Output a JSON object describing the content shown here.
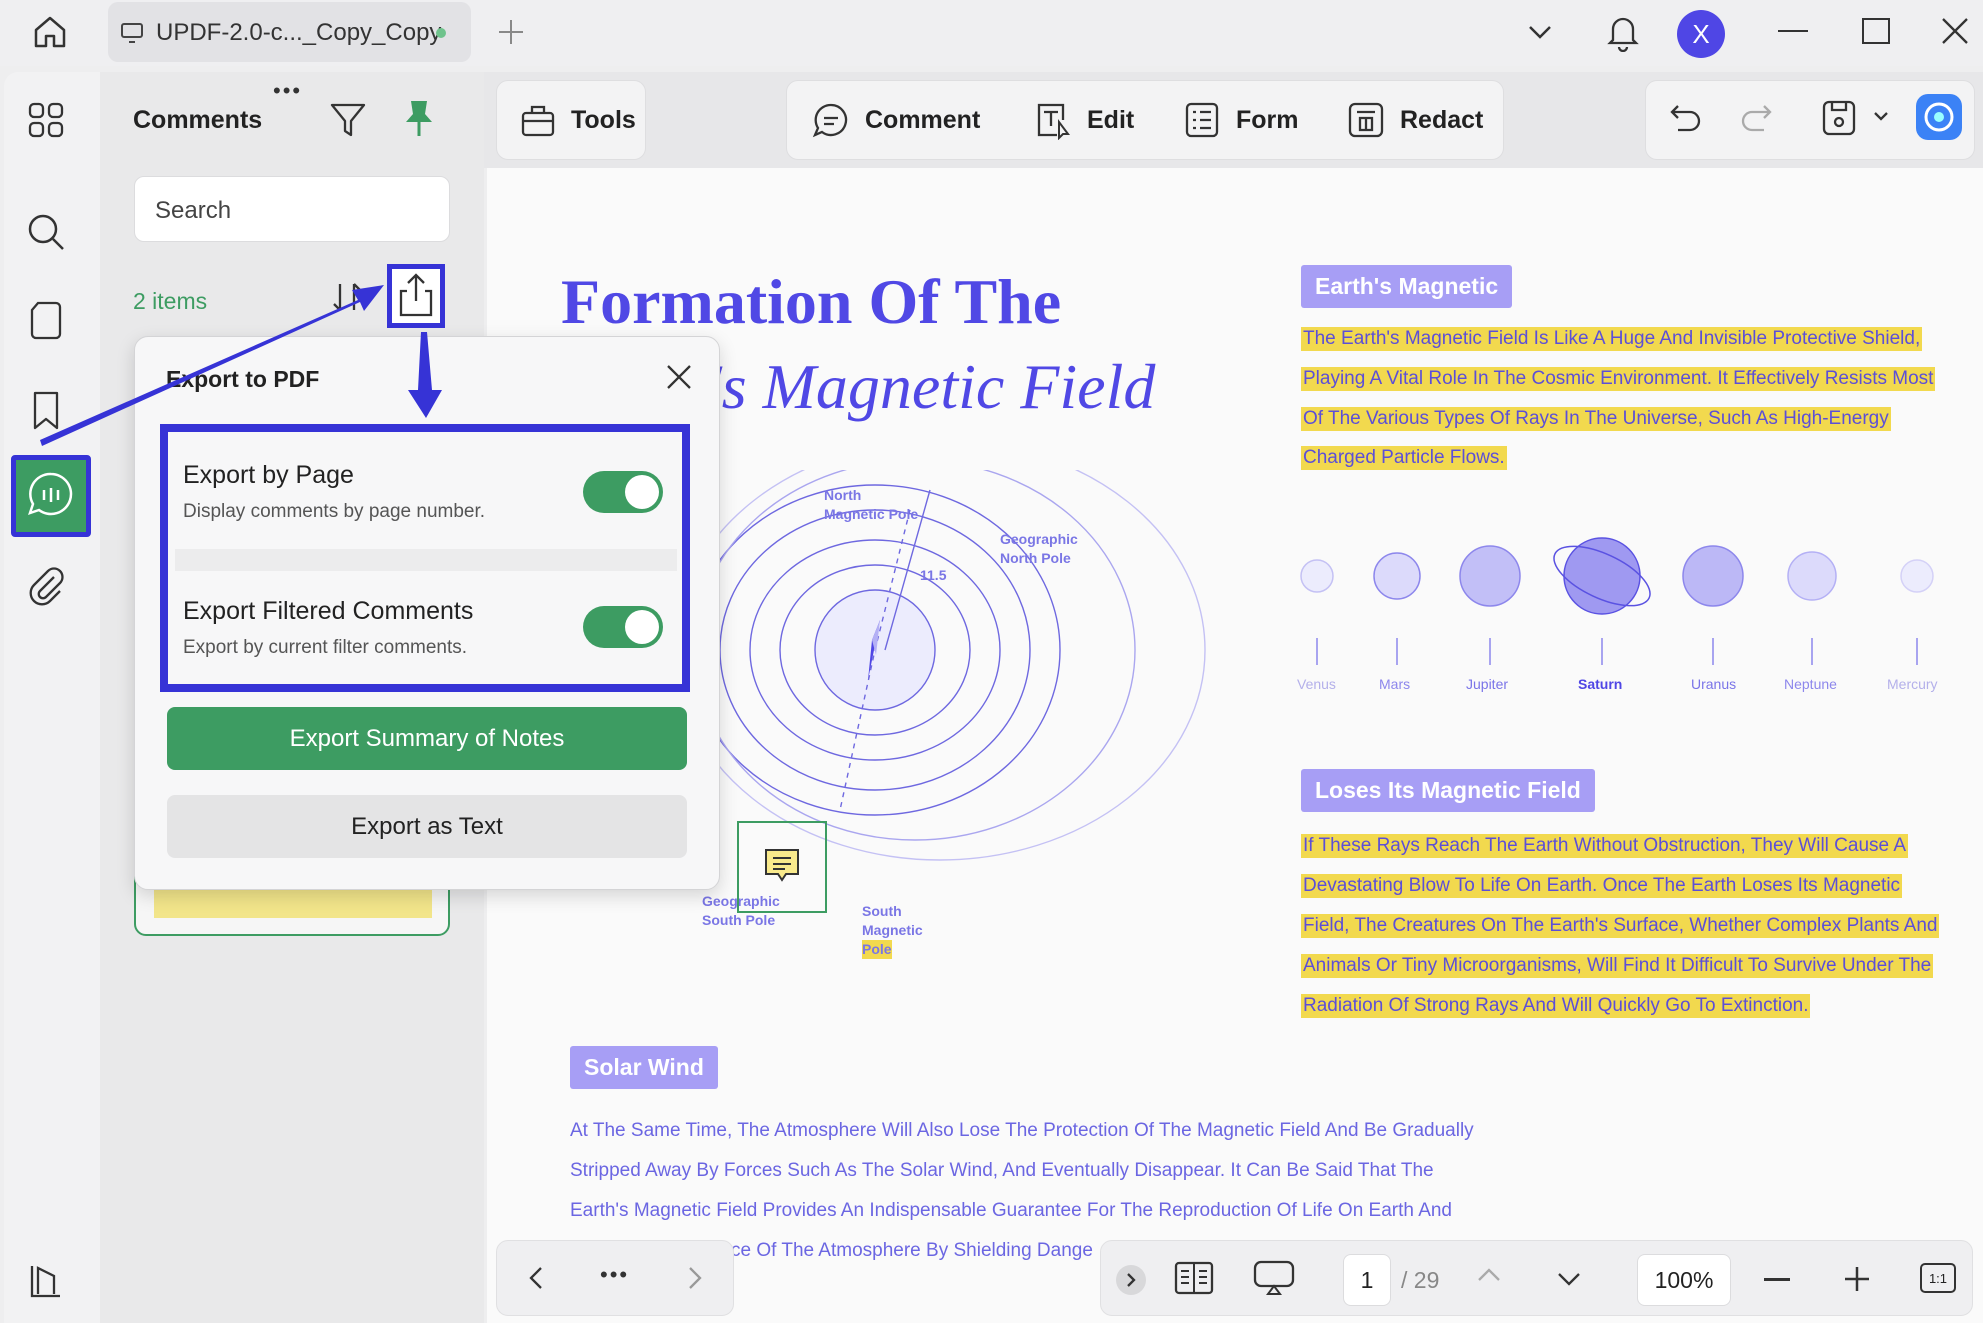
{
  "tab": {
    "title": "UPDF-2.0-c..._Copy_Copy"
  },
  "user": {
    "initial": "X"
  },
  "comments_panel": {
    "title": "Comments",
    "search_placeholder": "Search",
    "items_count": "2 items"
  },
  "toolbar": {
    "tools": "Tools",
    "comment": "Comment",
    "edit": "Edit",
    "form": "Form",
    "redact": "Redact"
  },
  "export_popup": {
    "title": "Export to PDF",
    "options": [
      {
        "title": "Export by Page",
        "subtitle": "Display comments by page number.",
        "enabled": true
      },
      {
        "title": "Export Filtered Comments",
        "subtitle": "Export by current filter comments.",
        "enabled": true
      }
    ],
    "primary_button": "Export Summary of Notes",
    "secondary_button": "Export as Text"
  },
  "document": {
    "heading_line1": "Formation Of The",
    "heading_line2": "'s Magnetic Field",
    "section1_title": "Earth's Magnetic",
    "section1_lines": [
      "The Earth's Magnetic Field Is Like A Huge And Invisible Protective Shield,",
      "Playing A Vital Role In The Cosmic Environment. It Effectively Resists Most",
      "Of The Various Types Of Rays In The Universe, Such As High-Energy",
      "Charged Particle Flows."
    ],
    "planets": [
      "Venus",
      "Mars",
      "Jupiter",
      "Saturn",
      "Uranus",
      "Neptune",
      "Mercury"
    ],
    "section2_title": "Loses Its Magnetic Field",
    "section2_lines": [
      "If These Rays Reach The Earth Without Obstruction, They Will Cause A",
      "Devastating Blow To Life On Earth. Once The Earth Loses Its Magnetic",
      "Field, The Creatures On The Earth's Surface, Whether Complex Plants And",
      "Animals Or Tiny Microorganisms, Will Find It Difficult To Survive Under The",
      "Radiation Of Strong Rays And Will Quickly Go To Extinction."
    ],
    "section3_title": "Solar Wind",
    "section3_lines": [
      "At The Same Time, The Atmosphere Will Also Lose The Protection Of The Magnetic Field And Be Gradually",
      "Stripped Away By Forces Such As The Solar Wind, And Eventually Disappear. It Can Be Said That The",
      "Earth's Magnetic Field Provides An Indispensable Guarantee For The Reproduction Of Life On Earth And",
      "ce Of The Atmosphere By Shielding Dange"
    ],
    "diagram_labels": {
      "north_magnetic_1": "North",
      "north_magnetic_2": "Magnetic Pole",
      "geo_north_1": "Geographic",
      "geo_north_2": "North Pole",
      "angle": "11.5",
      "geo_south_1": "Geographic",
      "geo_south_2": "South Pole",
      "south_mag_1": "South",
      "south_mag_2": "Magnetic",
      "south_mag_3": "Pole"
    }
  },
  "bottom_bar": {
    "current_page": "1",
    "total_pages": "/ 29",
    "zoom": "100%",
    "fit_label": "1:1"
  }
}
